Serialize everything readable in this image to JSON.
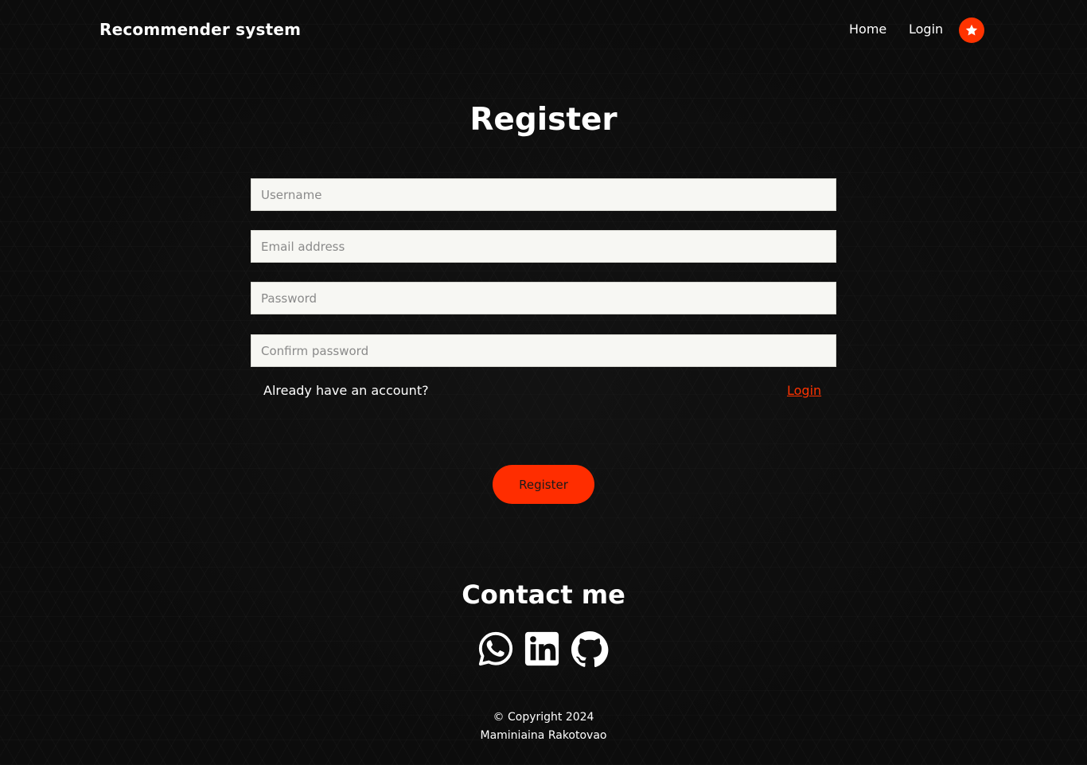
{
  "navbar": {
    "brand": "Recommender system",
    "home_label": "Home",
    "login_label": "Login",
    "star_icon": "star-icon",
    "accent_color": "#ff3300"
  },
  "form": {
    "title": "Register",
    "username_placeholder": "Username",
    "email_placeholder": "Email address",
    "password_placeholder": "Password",
    "confirm_placeholder": "Confirm password",
    "already_text": "Already have an account?",
    "login_link": "Login",
    "submit_label": "Register"
  },
  "contact": {
    "title": "Contact me",
    "icons": [
      "whatsapp-icon",
      "linkedin-icon",
      "github-icon"
    ]
  },
  "footer": {
    "copyright": "© Copyright 2024",
    "author": "Maminiaina Rakotovao"
  }
}
